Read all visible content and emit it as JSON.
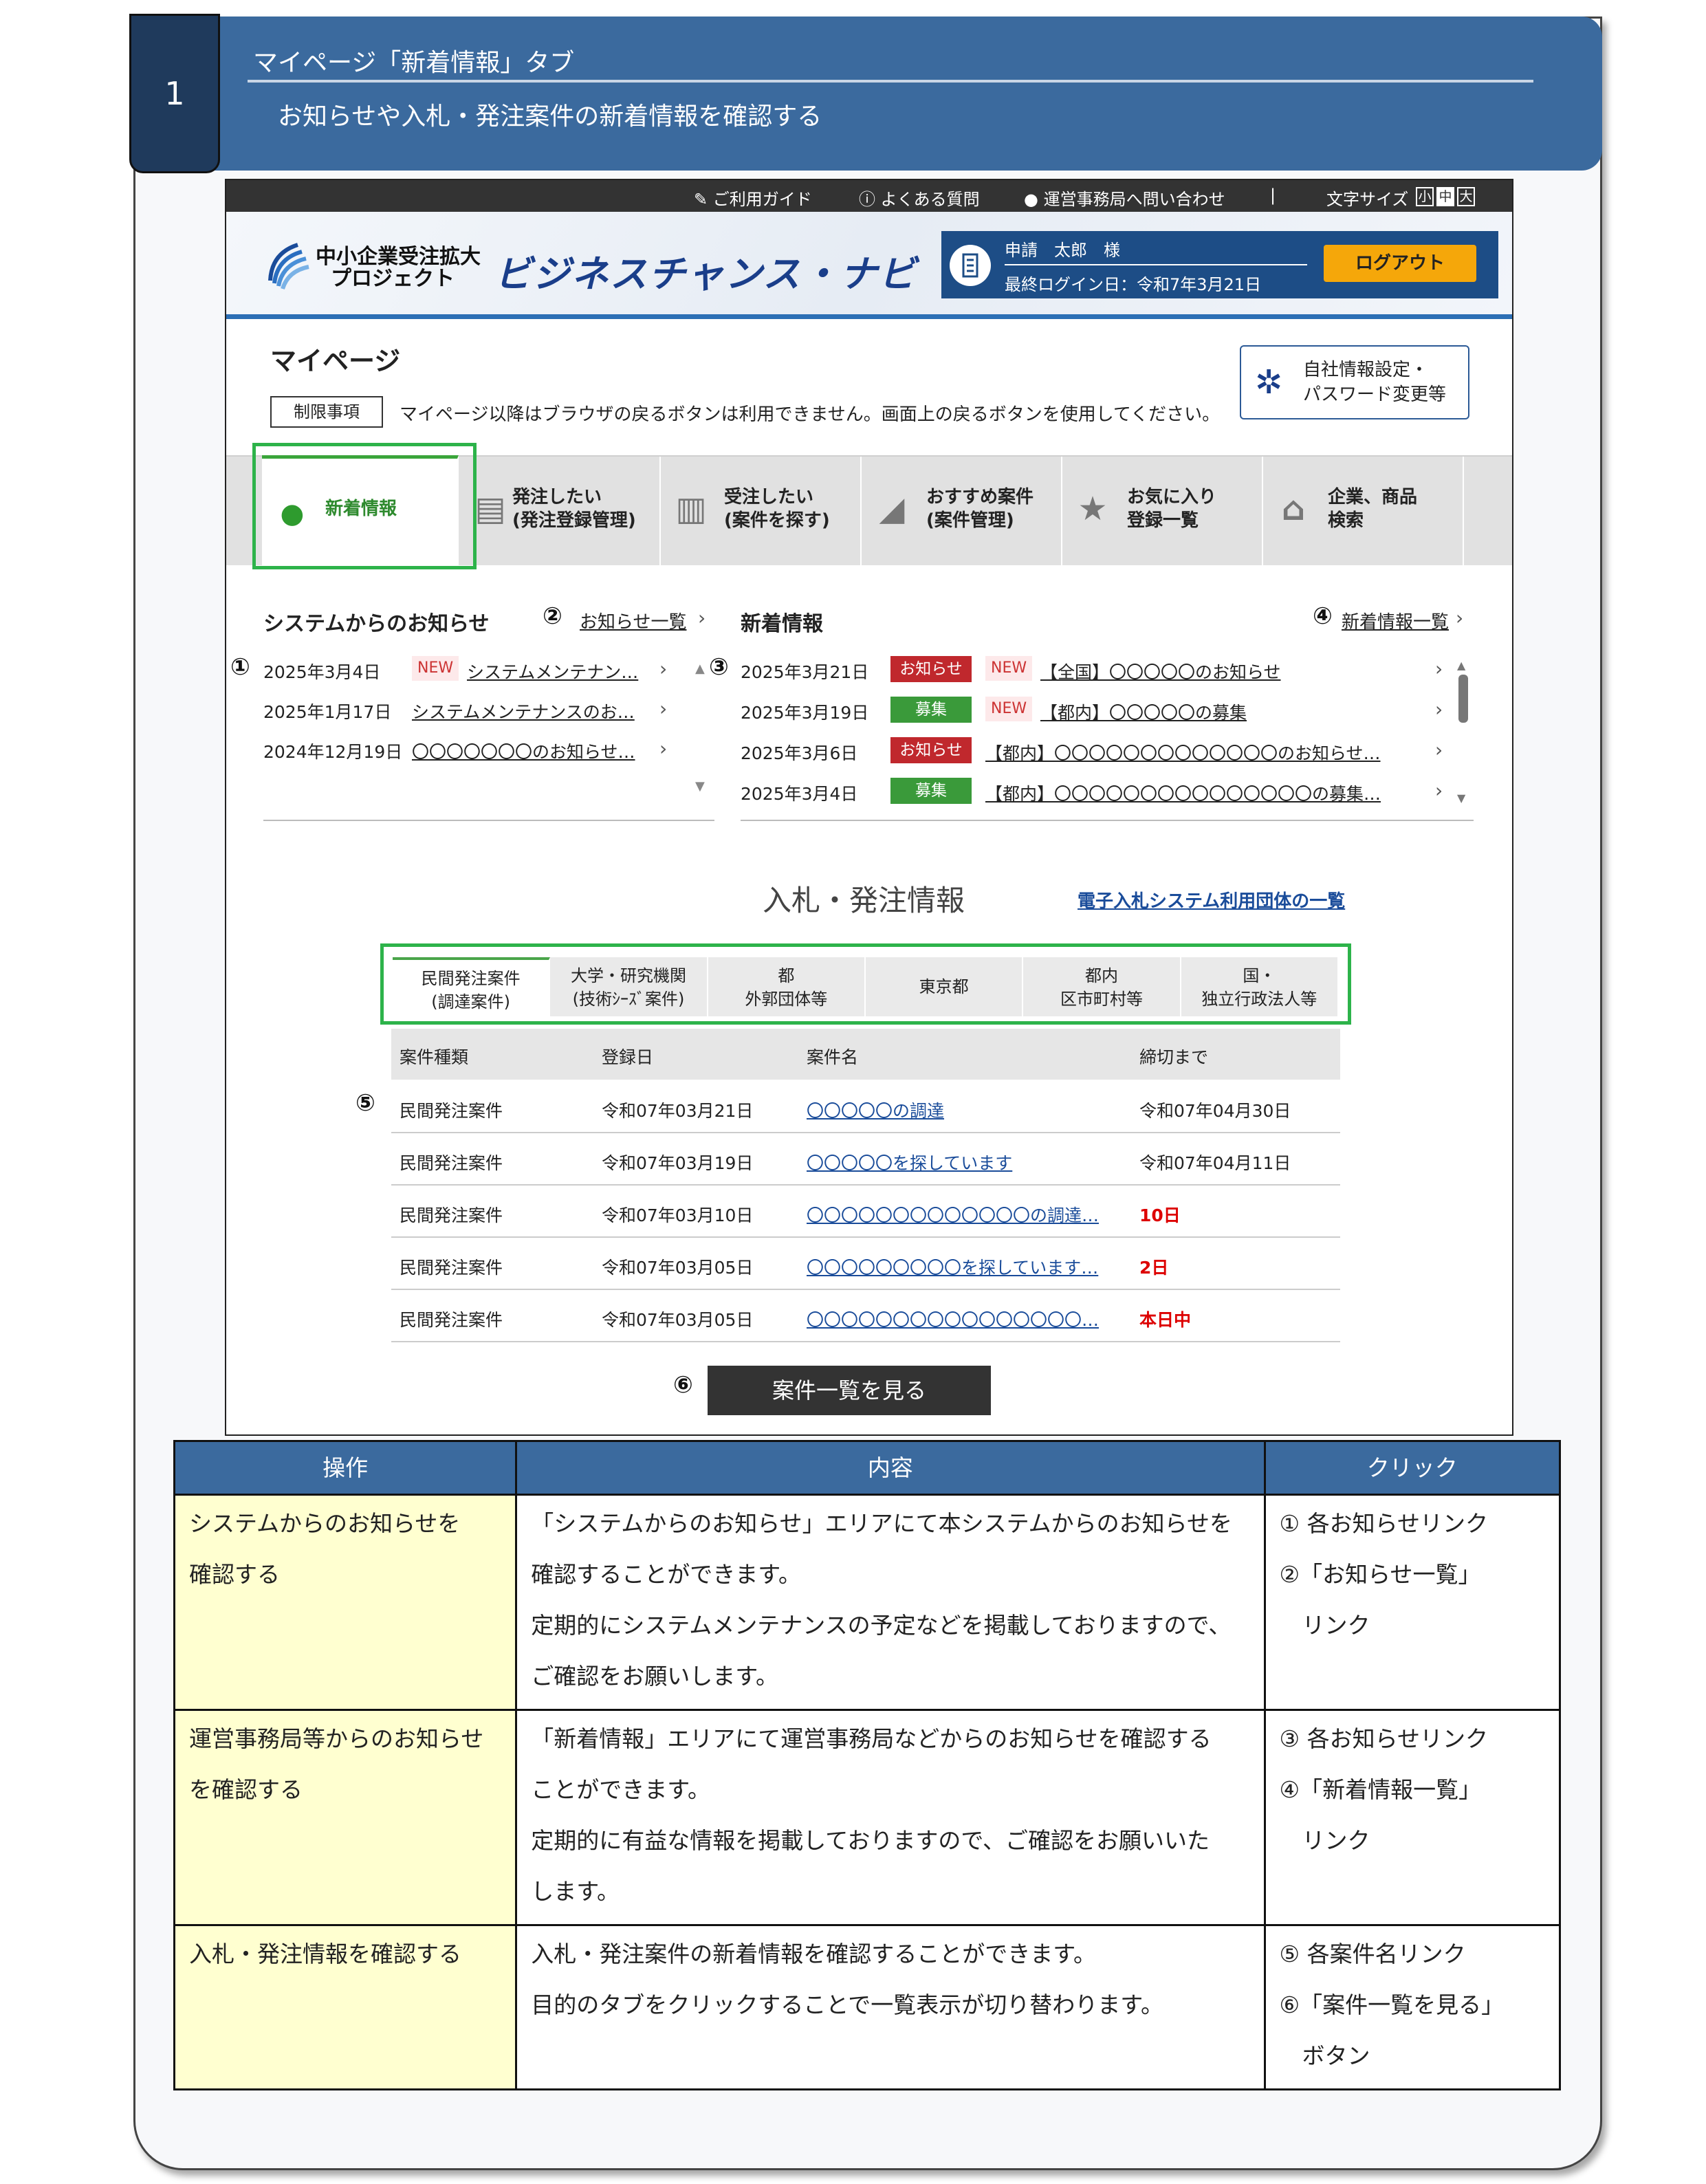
{
  "section": {
    "number": "1",
    "title": "マイページ「新着情報」タブ",
    "subtitle": "お知らせや入札・発注案件の新着情報を確認する"
  },
  "topbar": {
    "guide": "ご利用ガイド",
    "faq": "よくある質問",
    "contact": "運営事務局へ問い合わせ",
    "sep": "|",
    "fontsize_label": "文字サイズ",
    "fontsizes": [
      "小",
      "中",
      "大"
    ]
  },
  "header": {
    "logo_line1": "中小企業受注拡大",
    "logo_line2": "プロジェクト",
    "brand": "ビジネスチャンス・ナビ",
    "user": "申請　太郎　様",
    "last_login": "最終ログイン日：令和7年3月21日",
    "logout": "ログアウト"
  },
  "mypage": {
    "title": "マイページ",
    "restriction_label": "制限事項",
    "restriction_text": "マイページ以降はブラウザの戻るボタンは利用できません。画面上の戻るボタンを使用してください。",
    "settings_line1": "自社情報設定・",
    "settings_line2": "パスワード変更等"
  },
  "tabs": [
    {
      "label": "新着情報"
    },
    {
      "label": "発注したい\n(発注登録管理)"
    },
    {
      "label": "受注したい\n(案件を探す)"
    },
    {
      "label": "おすすめ案件\n(案件管理)"
    },
    {
      "label": "お気に入り\n登録一覧"
    },
    {
      "label": "企業、商品\n検索"
    }
  ],
  "system_notices": {
    "heading": "システムからのお知らせ",
    "more_link": "お知らせ一覧",
    "items": [
      {
        "date": "2025年3月4日",
        "new": "NEW",
        "title": "システムメンテナン…"
      },
      {
        "date": "2025年1月17日",
        "title": "システムメンテナンスのお…"
      },
      {
        "date": "2024年12月19日",
        "title": "〇〇〇〇〇〇〇のお知らせ…"
      }
    ]
  },
  "news": {
    "heading": "新着情報",
    "more_link": "新着情報一覧",
    "items": [
      {
        "date": "2025年3月21日",
        "badge": "お知らせ",
        "new": "NEW",
        "title": "【全国】〇〇〇〇〇のお知らせ"
      },
      {
        "date": "2025年3月19日",
        "badge": "募集",
        "new": "NEW",
        "title": "【都内】〇〇〇〇〇の募集"
      },
      {
        "date": "2025年3月6日",
        "badge": "お知らせ",
        "title": "【都内】〇〇〇〇〇〇〇〇〇〇〇〇〇のお知らせ…"
      },
      {
        "date": "2025年3月4日",
        "badge": "募集",
        "title": "【都内】〇〇〇〇〇〇〇〇〇〇〇〇〇〇〇の募集…"
      }
    ],
    "colors": {
      "notice": "#c0282d",
      "recruit": "#3a9a3a"
    }
  },
  "bids": {
    "heading": "入札・発注情報",
    "directory_link": "電子入札システム利用団体の一覧",
    "tabs": [
      "民間発注案件\n(調達案件)",
      "大学・研究機関\n(技術ｼｰｽﾞ案件)",
      "都\n外郭団体等",
      "東京都",
      "都内\n区市町村等",
      "国・\n独立行政法人等"
    ],
    "columns": [
      "案件種類",
      "登録日",
      "案件名",
      "締切まで"
    ],
    "rows": [
      {
        "type": "民間発注案件",
        "date": "令和07年03月21日",
        "name": "〇〇〇〇〇の調達",
        "deadline": "令和07年04月30日"
      },
      {
        "type": "民間発注案件",
        "date": "令和07年03月19日",
        "name": "〇〇〇〇〇を探しています",
        "deadline": "令和07年04月11日"
      },
      {
        "type": "民間発注案件",
        "date": "令和07年03月10日",
        "name": "〇〇〇〇〇〇〇〇〇〇〇〇〇の調達…",
        "deadline": "10日"
      },
      {
        "type": "民間発注案件",
        "date": "令和07年03月05日",
        "name": "〇〇〇〇〇〇〇〇〇を探しています…",
        "deadline": "2日"
      },
      {
        "type": "民間発注案件",
        "date": "令和07年03月05日",
        "name": "〇〇〇〇〇〇〇〇〇〇〇〇〇〇〇〇…",
        "deadline": "本日中"
      }
    ],
    "view_all": "案件一覧を見る"
  },
  "markers": [
    "①",
    "②",
    "③",
    "④",
    "⑤",
    "⑥"
  ],
  "explain": {
    "headers": [
      "操作",
      "内容",
      "クリック"
    ],
    "rows": [
      {
        "op": [
          "システムからのお知らせを",
          "確認する"
        ],
        "content": [
          "「システムからのお知らせ」エリアにて本システムからのお知らせを",
          "確認することができます。",
          "定期的にシステムメンテナンスの予定などを掲載しておりますので、",
          "ご確認をお願いします。"
        ],
        "click": [
          "①  各お知らせリンク",
          "②「お知らせ一覧」",
          "　リンク"
        ]
      },
      {
        "op": [
          "運営事務局等からのお知らせ",
          "を確認する"
        ],
        "content": [
          "「新着情報」エリアにて運営事務局などからのお知らせを確認する",
          "ことができます。",
          "定期的に有益な情報を掲載しておりますので、ご確認をお願いいた",
          "します。"
        ],
        "click": [
          "③  各お知らせリンク",
          "④「新着情報一覧」",
          "　リンク"
        ]
      },
      {
        "op": [
          "入札・発注情報を確認する"
        ],
        "content": [
          "入札・発注案件の新着情報を確認することができます。",
          "目的のタブをクリックすることで一覧表示が切り替わります。"
        ],
        "click": [
          "⑤  各案件名リンク",
          "⑥「案件一覧を見る」",
          "　ボタン"
        ]
      }
    ]
  }
}
